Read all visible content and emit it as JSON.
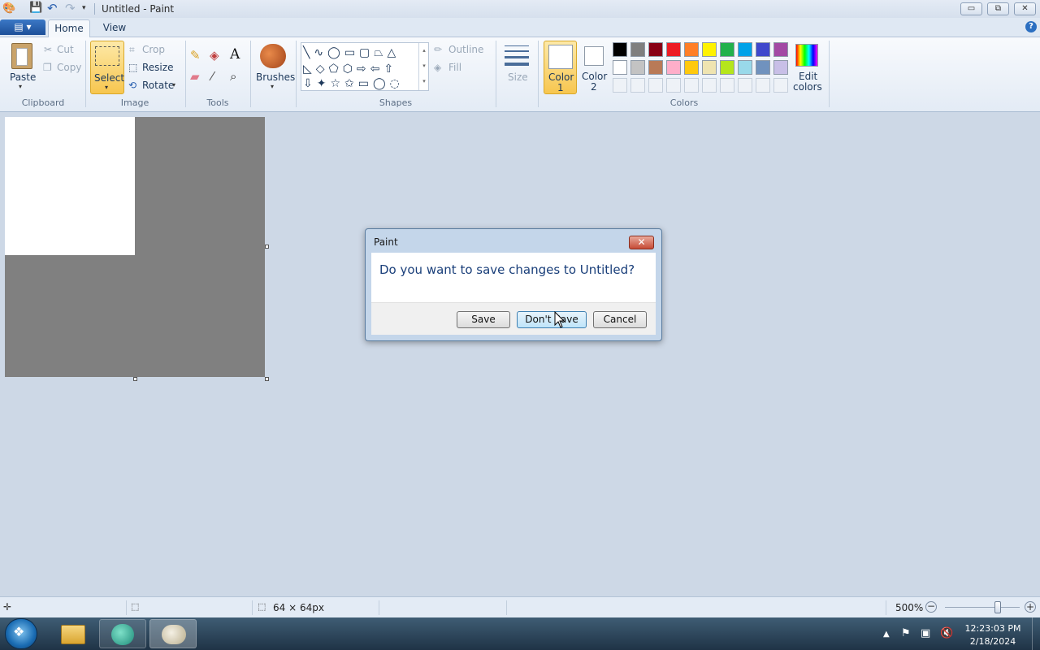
{
  "window": {
    "title": "Untitled - Paint",
    "minimize_glyph": "▭",
    "restore_glyph": "⧉",
    "close_glyph": "✕"
  },
  "tabs": {
    "app_menu_glyph": "▤ ▾",
    "home": "Home",
    "view": "View",
    "help_glyph": "?"
  },
  "ribbon": {
    "clipboard": {
      "label": "Clipboard",
      "paste": "Paste",
      "cut": "Cut",
      "copy": "Copy"
    },
    "image": {
      "label": "Image",
      "select": "Select",
      "crop": "Crop",
      "resize": "Resize",
      "rotate": "Rotate"
    },
    "tools": {
      "label": "Tools"
    },
    "brushes": "Brushes",
    "shapes": {
      "label": "Shapes",
      "outline": "Outline",
      "fill": "Fill"
    },
    "size": "Size",
    "colors": {
      "label": "Colors",
      "color1": "Color",
      "color1_num": "1",
      "color2": "Color",
      "color2_num": "2",
      "edit_colors_line1": "Edit",
      "edit_colors_line2": "colors",
      "row1": [
        "#000000",
        "#7f7f7f",
        "#880015",
        "#ed1c24",
        "#ff7f27",
        "#fff200",
        "#22b14c",
        "#00a2e8",
        "#3f48cc",
        "#a349a4"
      ],
      "row2": [
        "#ffffff",
        "#c3c3c3",
        "#b97a57",
        "#ffaec9",
        "#ffc90e",
        "#efe4b0",
        "#b5e61d",
        "#99d9ea",
        "#7092be",
        "#c8bfe7"
      ]
    }
  },
  "dialog": {
    "title": "Paint",
    "message": "Do you want to save changes to Untitled?",
    "save": "Save",
    "dont_save": "Don't Save",
    "cancel": "Cancel",
    "close_glyph": "✕"
  },
  "status": {
    "image_size": "64 × 64px",
    "zoom": "500%"
  },
  "taskbar": {
    "time": "12:23:03 PM",
    "date": "2/18/2024"
  }
}
